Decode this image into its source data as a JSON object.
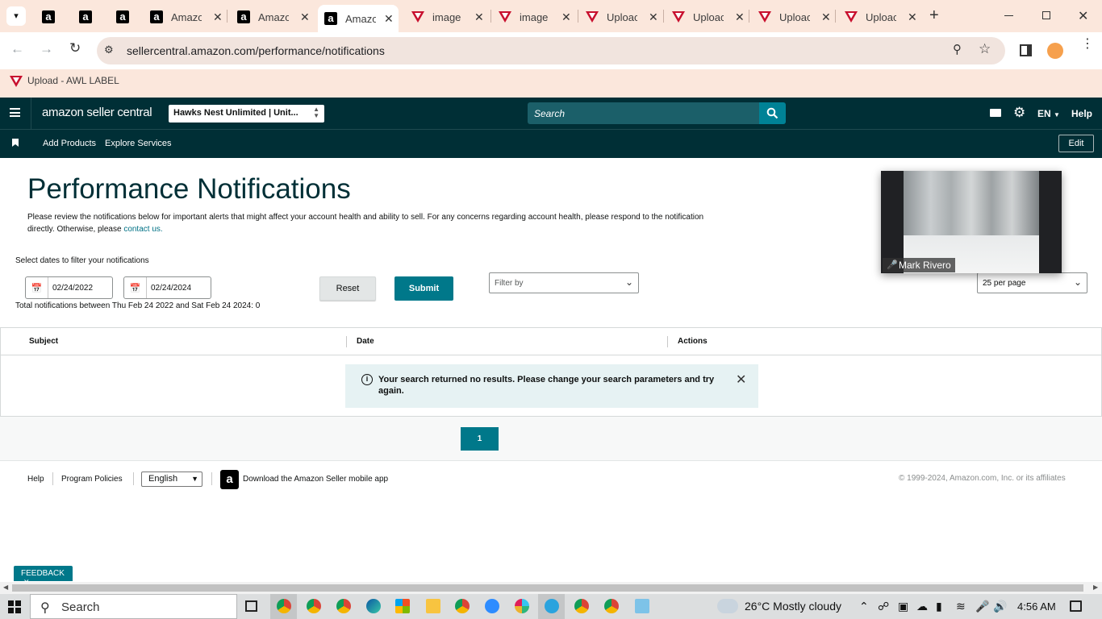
{
  "browser": {
    "tabs": [
      {
        "title": "",
        "favicon": "amazon-icon"
      },
      {
        "title": "",
        "favicon": "amazon-icon"
      },
      {
        "title": "",
        "favicon": "amazon-icon"
      },
      {
        "title": "Amazo",
        "favicon": "amazon-icon"
      },
      {
        "title": "Amazo",
        "favicon": "amazon-icon"
      },
      {
        "title": "Amazo",
        "favicon": "amazon-icon",
        "active": true
      },
      {
        "title": "image",
        "favicon": "awl-icon"
      },
      {
        "title": "image",
        "favicon": "awl-icon"
      },
      {
        "title": "Uploac",
        "favicon": "awl-icon"
      },
      {
        "title": "Uploac",
        "favicon": "awl-icon"
      },
      {
        "title": "Uploac",
        "favicon": "awl-icon"
      },
      {
        "title": "Uploac",
        "favicon": "awl-icon"
      }
    ],
    "url": "sellercentral.amazon.com/performance/notifications",
    "bookmark": "Upload - AWL LABEL"
  },
  "header": {
    "logo": "amazon seller central",
    "account": "Hawks Nest Unlimited | Unit...",
    "search_placeholder": "Search",
    "language": "EN",
    "help": "Help"
  },
  "nav": {
    "links": [
      "Add Products",
      "Explore Services"
    ],
    "edit": "Edit"
  },
  "main": {
    "title": "Performance Notifications",
    "intro": "Please review the notifications below for important alerts that might affect your account health and ability to sell. For any concerns regarding account health, please respond to the notification directly. Otherwise, please ",
    "intro_link": "contact us.",
    "filter_label": "Select dates to filter your notifications",
    "date_from": "02/24/2022",
    "date_to": "02/24/2024",
    "total": "Total notifications between Thu Feb 24 2022 and Sat Feb 24 2024: 0",
    "reset": "Reset",
    "submit": "Submit",
    "filter_by": "Filter by",
    "per_page": "25 per page"
  },
  "video": {
    "name": "Mark Rivero"
  },
  "table": {
    "columns": [
      "Subject",
      "Date",
      "Actions"
    ],
    "empty_message": "Your search returned no results. Please change your search parameters and try again."
  },
  "pagination": {
    "current": "1"
  },
  "footer": {
    "help": "Help",
    "policies": "Program Policies",
    "language": "English",
    "app": "Download the Amazon Seller mobile app",
    "copyright": "© 1999-2024, Amazon.com, Inc. or its affiliates",
    "feedback": "FEEDBACK"
  },
  "taskbar": {
    "search": "Search",
    "weather": "26°C  Mostly cloudy",
    "time": "4:56 AM"
  },
  "colors": {
    "header_bg": "#002f36",
    "accent": "#00788a",
    "tabstrip": "#fbe7dc"
  }
}
